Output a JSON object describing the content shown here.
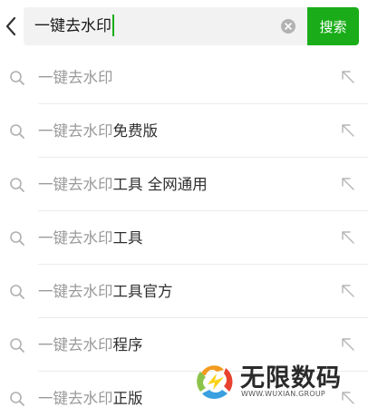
{
  "search": {
    "query": "一键去水印",
    "button_label": "搜索"
  },
  "icons": {
    "back": "chevron-left-icon",
    "clear": "clear-circle-icon",
    "suggestion": "search-icon",
    "fill": "arrow-up-left-icon"
  },
  "suggestions": [
    {
      "prefix": "一键去水印",
      "suffix": ""
    },
    {
      "prefix": "一键去水印",
      "suffix": "免费版"
    },
    {
      "prefix": "一键去水印",
      "suffix": "工具 全网通用"
    },
    {
      "prefix": "一键去水印",
      "suffix": "工具"
    },
    {
      "prefix": "一键去水印",
      "suffix": "工具官方"
    },
    {
      "prefix": "一键去水印",
      "suffix": "程序"
    },
    {
      "prefix": "一键去水印",
      "suffix": "正版"
    }
  ],
  "watermark": {
    "title": "无限数码",
    "url": "WWW.WUXIAN.GROUP"
  },
  "colors": {
    "accent": "#1aad19",
    "input_bg": "#f2f2f2",
    "divider": "#ececec",
    "prefix_text": "#9a9a9a"
  }
}
